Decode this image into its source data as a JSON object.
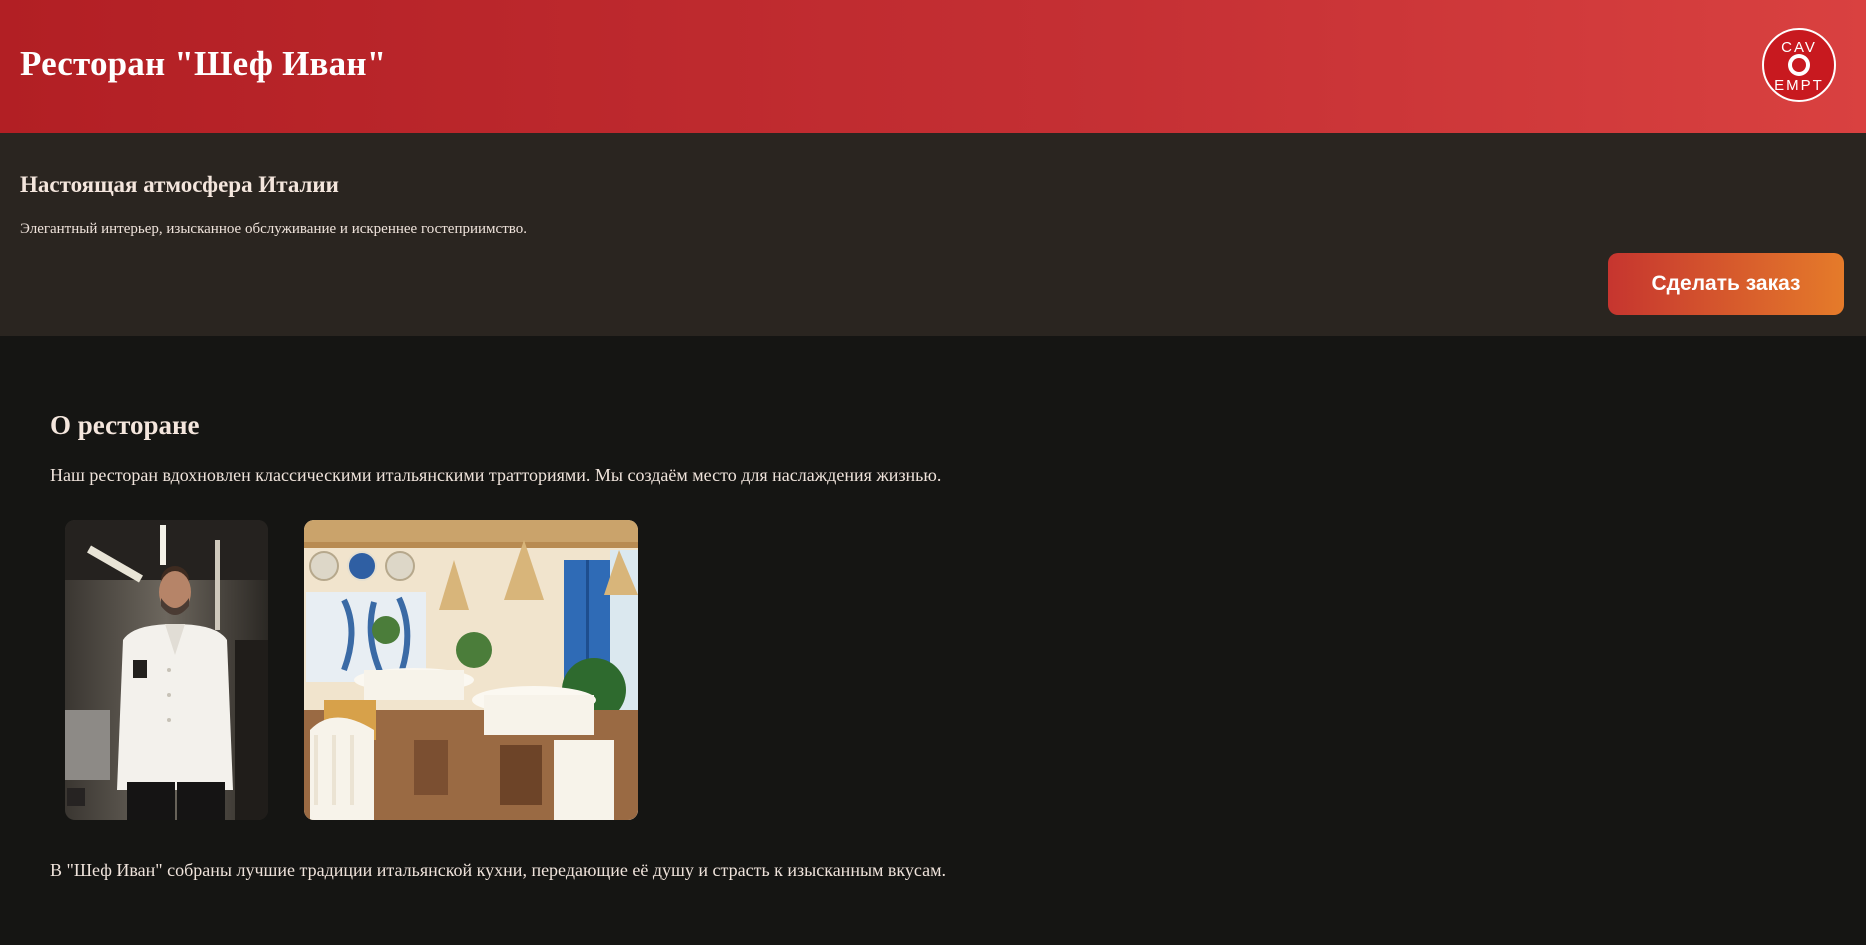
{
  "header": {
    "title": "Ресторан \"Шеф Иван\"",
    "logo_text": "CAVEMPT"
  },
  "hero": {
    "title": "Настоящая атмосфера Италии",
    "text": "Элегантный интерьер, изысканное обслуживание и искреннее гостеприимство.",
    "button_label": "Сделать заказ"
  },
  "about": {
    "title": "О ресторане",
    "text": "Наш ресторан вдохновлен классическими итальянскими тратториями. Мы создаём место для наслаждения жизнью.",
    "closing_text": "В \"Шеф Иван\" собраны лучшие традиции итальянской кухни, передающие её душу и страсть к изысканным вкусам."
  },
  "colors": {
    "header_red": "#c53034",
    "hero_bg": "#2a2520",
    "page_bg": "#151513",
    "button_gradient_start": "#c6352f",
    "button_gradient_end": "#e57b2a"
  }
}
